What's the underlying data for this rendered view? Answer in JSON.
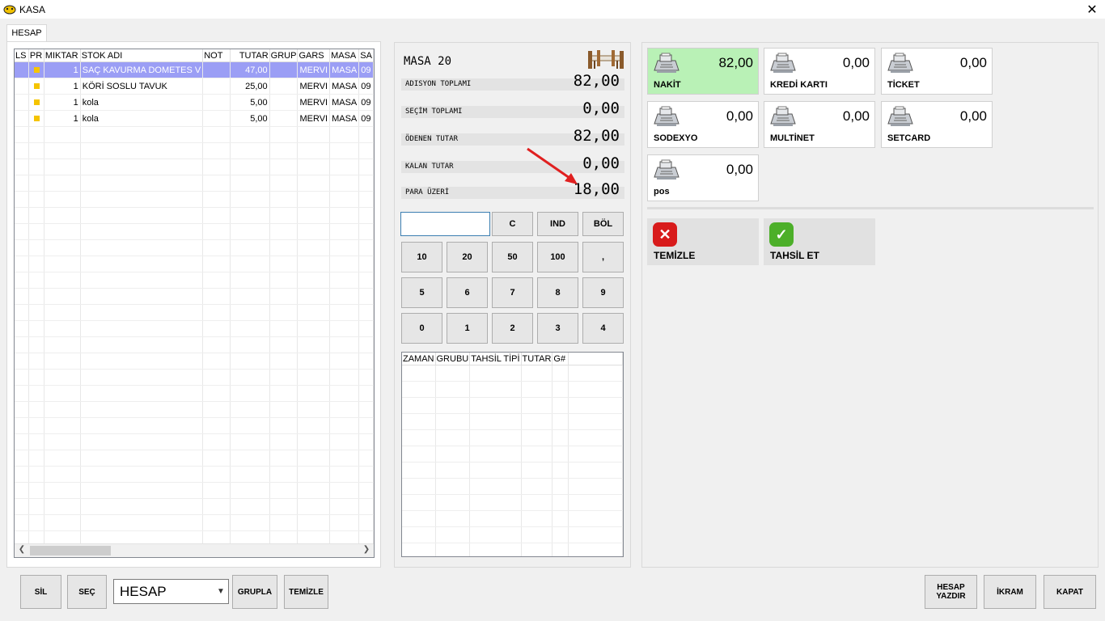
{
  "window": {
    "title": "KASA",
    "close_label": "✕"
  },
  "tabs": [
    {
      "label": "HESAP"
    }
  ],
  "order_grid": {
    "columns": [
      "LS",
      "PR",
      "MIKTAR",
      "STOK ADI",
      "NOT",
      "TUTAR",
      "GRUP",
      "GARS",
      "MASA",
      "SA"
    ],
    "rows": [
      {
        "ls": "",
        "miktar": "1",
        "stok_adi": "SAÇ KAVURMA DOMETES V",
        "not": "",
        "tutar": "47,00",
        "grup": "",
        "gars": "MERVI",
        "masa": "MASA",
        "sa": "09"
      },
      {
        "ls": "",
        "miktar": "1",
        "stok_adi": "KÖRİ SOSLU TAVUK",
        "not": "",
        "tutar": "25,00",
        "grup": "",
        "gars": "MERVI",
        "masa": "MASA",
        "sa": "09"
      },
      {
        "ls": "",
        "miktar": "1",
        "stok_adi": "kola",
        "not": "",
        "tutar": "5,00",
        "grup": "",
        "gars": "MERVI",
        "masa": "MASA",
        "sa": "09"
      },
      {
        "ls": "",
        "miktar": "1",
        "stok_adi": "kola",
        "not": "",
        "tutar": "5,00",
        "grup": "",
        "gars": "MERVI",
        "masa": "MASA",
        "sa": "09"
      }
    ],
    "selected_row": 0
  },
  "totals": {
    "masa": "MASA 20",
    "adisyon_label": "ADISYON TOPLAMI",
    "adisyon_value": "82,00",
    "secim_label": "SEÇİM TOPLAMI",
    "secim_value": "0,00",
    "odenen_label": "ÖDENEN TUTAR",
    "odenen_value": "82,00",
    "kalan_label": "KALAN TUTAR",
    "kalan_value": "0,00",
    "para_label": "PARA ÜZERİ",
    "para_value": "18,00"
  },
  "entry": {
    "value": ""
  },
  "keypad": {
    "row0": [
      "C",
      "IND",
      "BÖL"
    ],
    "row1": [
      "10",
      "20",
      "50",
      "100",
      ","
    ],
    "row2": [
      "5",
      "6",
      "7",
      "8",
      "9"
    ],
    "row3": [
      "0",
      "1",
      "2",
      "3",
      "4"
    ]
  },
  "payment_grid": {
    "columns": [
      "ZAMAN",
      "GRUBU",
      "TAHSİL TİPİ",
      "TUTAR",
      "G#"
    ],
    "rows": []
  },
  "payment_types": [
    {
      "label": "NAKİT",
      "value": "82,00",
      "active": true
    },
    {
      "label": "KREDİ KARTI",
      "value": "0,00",
      "active": false
    },
    {
      "label": "TİCKET",
      "value": "0,00",
      "active": false
    },
    {
      "label": "SODEXYO",
      "value": "0,00",
      "active": false
    },
    {
      "label": "MULTİNET",
      "value": "0,00",
      "active": false
    },
    {
      "label": "SETCARD",
      "value": "0,00",
      "active": false
    },
    {
      "label": "pos",
      "value": "0,00",
      "active": false
    }
  ],
  "actions": {
    "temizle": "TEMİZLE",
    "tahsil": "TAHSİL ET"
  },
  "bottom": {
    "sil": "SİL",
    "sec": "SEÇ",
    "select_value": "HESAP",
    "grupla": "GRUPLA",
    "temizle": "TEMİZLE",
    "hesap_yazdir_1": "HESAP",
    "hesap_yazdir_2": "YAZDIR",
    "ikram": "İKRAM",
    "kapat": "KAPAT"
  },
  "colors": {
    "selected_row": "#9b9ef5",
    "active_payment": "#b9f1b6",
    "accent_green": "#4caf29",
    "accent_red": "#d81b1b"
  }
}
